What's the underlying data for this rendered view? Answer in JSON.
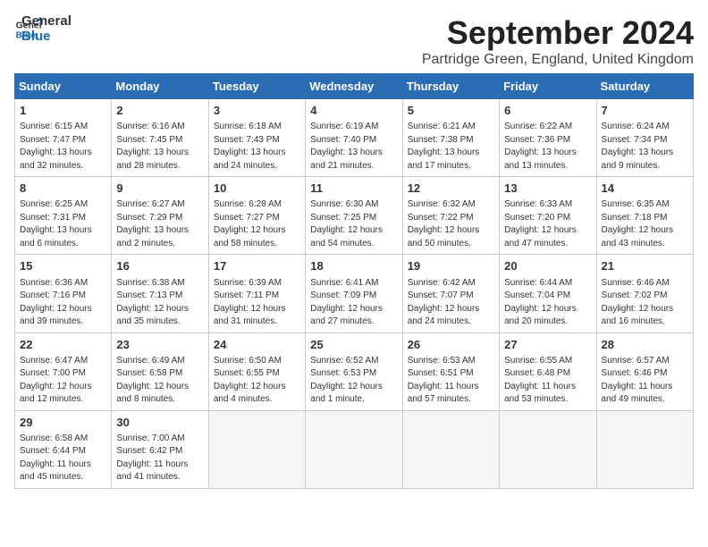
{
  "logo": {
    "line1": "General",
    "line2": "Blue"
  },
  "title": "September 2024",
  "subtitle": "Partridge Green, England, United Kingdom",
  "weekdays": [
    "Sunday",
    "Monday",
    "Tuesday",
    "Wednesday",
    "Thursday",
    "Friday",
    "Saturday"
  ],
  "weeks": [
    [
      {
        "day": "1",
        "info": "Sunrise: 6:15 AM\nSunset: 7:47 PM\nDaylight: 13 hours\nand 32 minutes."
      },
      {
        "day": "2",
        "info": "Sunrise: 6:16 AM\nSunset: 7:45 PM\nDaylight: 13 hours\nand 28 minutes."
      },
      {
        "day": "3",
        "info": "Sunrise: 6:18 AM\nSunset: 7:43 PM\nDaylight: 13 hours\nand 24 minutes."
      },
      {
        "day": "4",
        "info": "Sunrise: 6:19 AM\nSunset: 7:40 PM\nDaylight: 13 hours\nand 21 minutes."
      },
      {
        "day": "5",
        "info": "Sunrise: 6:21 AM\nSunset: 7:38 PM\nDaylight: 13 hours\nand 17 minutes."
      },
      {
        "day": "6",
        "info": "Sunrise: 6:22 AM\nSunset: 7:36 PM\nDaylight: 13 hours\nand 13 minutes."
      },
      {
        "day": "7",
        "info": "Sunrise: 6:24 AM\nSunset: 7:34 PM\nDaylight: 13 hours\nand 9 minutes."
      }
    ],
    [
      {
        "day": "8",
        "info": "Sunrise: 6:25 AM\nSunset: 7:31 PM\nDaylight: 13 hours\nand 6 minutes."
      },
      {
        "day": "9",
        "info": "Sunrise: 6:27 AM\nSunset: 7:29 PM\nDaylight: 13 hours\nand 2 minutes."
      },
      {
        "day": "10",
        "info": "Sunrise: 6:28 AM\nSunset: 7:27 PM\nDaylight: 12 hours\nand 58 minutes."
      },
      {
        "day": "11",
        "info": "Sunrise: 6:30 AM\nSunset: 7:25 PM\nDaylight: 12 hours\nand 54 minutes."
      },
      {
        "day": "12",
        "info": "Sunrise: 6:32 AM\nSunset: 7:22 PM\nDaylight: 12 hours\nand 50 minutes."
      },
      {
        "day": "13",
        "info": "Sunrise: 6:33 AM\nSunset: 7:20 PM\nDaylight: 12 hours\nand 47 minutes."
      },
      {
        "day": "14",
        "info": "Sunrise: 6:35 AM\nSunset: 7:18 PM\nDaylight: 12 hours\nand 43 minutes."
      }
    ],
    [
      {
        "day": "15",
        "info": "Sunrise: 6:36 AM\nSunset: 7:16 PM\nDaylight: 12 hours\nand 39 minutes."
      },
      {
        "day": "16",
        "info": "Sunrise: 6:38 AM\nSunset: 7:13 PM\nDaylight: 12 hours\nand 35 minutes."
      },
      {
        "day": "17",
        "info": "Sunrise: 6:39 AM\nSunset: 7:11 PM\nDaylight: 12 hours\nand 31 minutes."
      },
      {
        "day": "18",
        "info": "Sunrise: 6:41 AM\nSunset: 7:09 PM\nDaylight: 12 hours\nand 27 minutes."
      },
      {
        "day": "19",
        "info": "Sunrise: 6:42 AM\nSunset: 7:07 PM\nDaylight: 12 hours\nand 24 minutes."
      },
      {
        "day": "20",
        "info": "Sunrise: 6:44 AM\nSunset: 7:04 PM\nDaylight: 12 hours\nand 20 minutes."
      },
      {
        "day": "21",
        "info": "Sunrise: 6:46 AM\nSunset: 7:02 PM\nDaylight: 12 hours\nand 16 minutes."
      }
    ],
    [
      {
        "day": "22",
        "info": "Sunrise: 6:47 AM\nSunset: 7:00 PM\nDaylight: 12 hours\nand 12 minutes."
      },
      {
        "day": "23",
        "info": "Sunrise: 6:49 AM\nSunset: 6:58 PM\nDaylight: 12 hours\nand 8 minutes."
      },
      {
        "day": "24",
        "info": "Sunrise: 6:50 AM\nSunset: 6:55 PM\nDaylight: 12 hours\nand 4 minutes."
      },
      {
        "day": "25",
        "info": "Sunrise: 6:52 AM\nSunset: 6:53 PM\nDaylight: 12 hours\nand 1 minute."
      },
      {
        "day": "26",
        "info": "Sunrise: 6:53 AM\nSunset: 6:51 PM\nDaylight: 11 hours\nand 57 minutes."
      },
      {
        "day": "27",
        "info": "Sunrise: 6:55 AM\nSunset: 6:48 PM\nDaylight: 11 hours\nand 53 minutes."
      },
      {
        "day": "28",
        "info": "Sunrise: 6:57 AM\nSunset: 6:46 PM\nDaylight: 11 hours\nand 49 minutes."
      }
    ],
    [
      {
        "day": "29",
        "info": "Sunrise: 6:58 AM\nSunset: 6:44 PM\nDaylight: 11 hours\nand 45 minutes."
      },
      {
        "day": "30",
        "info": "Sunrise: 7:00 AM\nSunset: 6:42 PM\nDaylight: 11 hours\nand 41 minutes."
      },
      {
        "day": "",
        "info": ""
      },
      {
        "day": "",
        "info": ""
      },
      {
        "day": "",
        "info": ""
      },
      {
        "day": "",
        "info": ""
      },
      {
        "day": "",
        "info": ""
      }
    ]
  ]
}
